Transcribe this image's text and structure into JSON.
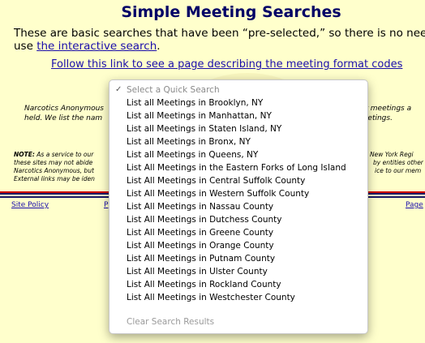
{
  "page": {
    "title": "Simple Meeting Searches",
    "intro_line1": "These are basic searches that have been “pre-selected,” so there is no need",
    "intro_use": "use ",
    "interactive_link": "the interactive search",
    "intro_after_link": ".",
    "format_link": "Follow this link to see a page describing the meeting format codes",
    "na_line1_left": "Narcotics Anonymous",
    "na_line1_right": "our meetings a",
    "na_line2_left": "held.  We list the nam",
    "na_line2_right": "he meetings.",
    "note_label": "NOTE:",
    "note_line1_left": " As a service to our",
    "note_line1_right": "New York Regi",
    "note_line2_left": "these sites may not abide",
    "note_line2_right": "by entities other",
    "note_line3_left": "Narcotics Anonymous, but",
    "note_line3_right": "ice to our mem",
    "note_line4_left": "External links may be iden",
    "footer_site_policy": "Site Policy",
    "footer_left_partial": "P",
    "footer_right_partial": "Page"
  },
  "colors": {
    "background": "#ffffcc",
    "title": "#000066",
    "link": "#1a0dab",
    "stripe_red": "#cc0000",
    "stripe_navy": "#1a1a66"
  },
  "dropdown": {
    "selected_mark": "✓",
    "placeholder": "Select a Quick Search",
    "options": [
      "List all Meetings in Brooklyn, NY",
      "List all Meetings in Manhattan, NY",
      "List all Meetings in Staten Island, NY",
      "List all Meetings in Bronx, NY",
      "List all Meetings in Queens, NY",
      "List All Meetings in the Eastern Forks of Long Island",
      "List All Meetings in Central Suffolk County",
      "List All Meetings in Western Suffolk County",
      "List All Meetings in Nassau County",
      "List All Meetings in Dutchess County",
      "List All Meetings in Greene County",
      "List All Meetings in Orange County",
      "List All Meetings in Putnam County",
      "List All Meetings in Ulster County",
      "List All Meetings in Rockland County",
      "List All Meetings in Westchester County"
    ],
    "clear_label": "Clear Search Results"
  }
}
